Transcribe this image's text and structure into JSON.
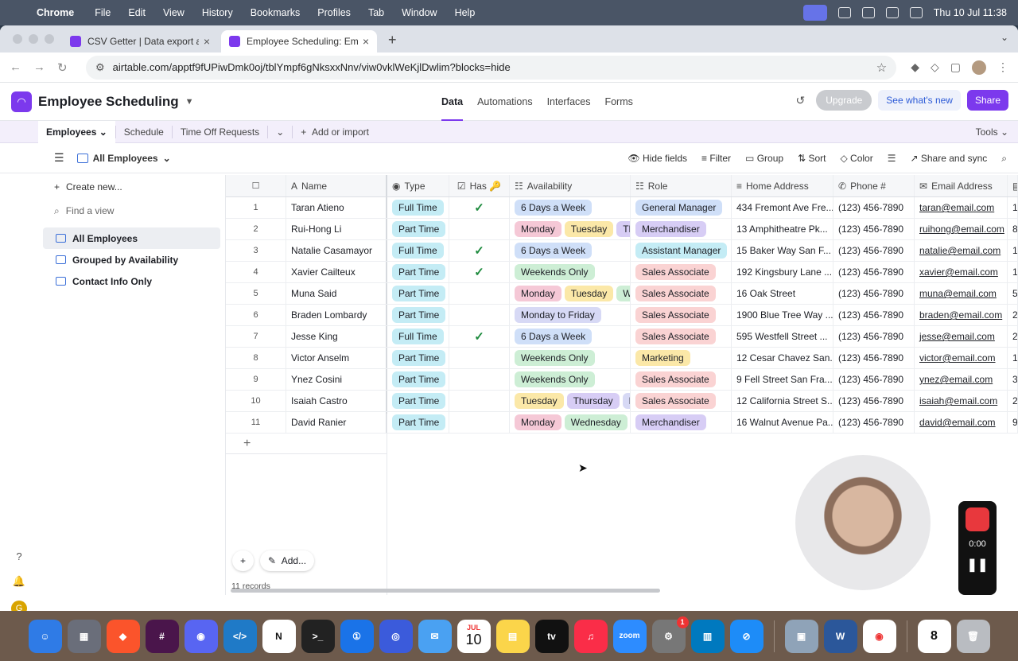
{
  "menubar": {
    "app": "Chrome",
    "items": [
      "File",
      "Edit",
      "View",
      "History",
      "Bookmarks",
      "Profiles",
      "Tab",
      "Window",
      "Help"
    ],
    "datetime": "Thu 10 Jul  11:38"
  },
  "browser": {
    "tabs": [
      {
        "title": "CSV Getter | Data export and",
        "favicon_color": "#7c39ed"
      },
      {
        "title": "Employee Scheduling: Emplo",
        "favicon_color": "#7c39ed"
      }
    ],
    "url": "airtable.com/apptf9fUPiwDmk0oj/tblYmpf6gNksxxNnv/viw0vklWeKjlDwlim?blocks=hide"
  },
  "app": {
    "base_name": "Employee Scheduling",
    "center_tabs": [
      "Data",
      "Automations",
      "Interfaces",
      "Forms"
    ],
    "upgrade": "Upgrade",
    "whats_new": "See what's new",
    "share": "Share"
  },
  "tables": {
    "active": "Employees",
    "others": [
      "Schedule",
      "Time Off Requests"
    ],
    "add": "Add or import",
    "tools": "Tools"
  },
  "view": {
    "name": "All Employees",
    "toolbar": [
      "Hide fields",
      "Filter",
      "Group",
      "Sort",
      "Color",
      "Share and sync"
    ]
  },
  "sidebar": {
    "create": "Create new...",
    "find_placeholder": "Find a view",
    "views": [
      "All Employees",
      "Grouped by Availability",
      "Contact Info Only"
    ]
  },
  "grid": {
    "columns": [
      "Name",
      "Type",
      "Has 🔑",
      "Availability",
      "Role",
      "Home Address",
      "Phone #",
      "Email Address"
    ],
    "rows": [
      {
        "n": "1",
        "name": "Taran Atieno",
        "type": "Full Time",
        "has": true,
        "avail": [
          [
            "6 Days a Week",
            "p-6d"
          ]
        ],
        "role": [
          "General Manager",
          "p-gm"
        ],
        "addr": "434 Fremont Ave Fre...",
        "phone": "(123) 456-7890",
        "email": "taran@email.com",
        "x": "1"
      },
      {
        "n": "2",
        "name": "Rui-Hong Li",
        "type": "Part Time",
        "has": false,
        "avail": [
          [
            "Monday",
            "p-mon"
          ],
          [
            "Tuesday",
            "p-tue"
          ],
          [
            "Thu",
            "p-thu"
          ]
        ],
        "role": [
          "Merchandiser",
          "p-mer"
        ],
        "addr": "13 Amphitheatre Pk...",
        "phone": "(123) 456-7890",
        "email": "ruihong@email.com",
        "x": "8"
      },
      {
        "n": "3",
        "name": "Natalie Casamayor",
        "type": "Full Time",
        "has": true,
        "avail": [
          [
            "6 Days a Week",
            "p-6d"
          ]
        ],
        "role": [
          "Assistant Manager",
          "p-am"
        ],
        "addr": "15 Baker Way San F...",
        "phone": "(123) 456-7890",
        "email": "natalie@email.com",
        "x": "1"
      },
      {
        "n": "4",
        "name": "Xavier Cailteux",
        "type": "Part Time",
        "has": true,
        "avail": [
          [
            "Weekends Only",
            "p-we"
          ]
        ],
        "role": [
          "Sales Associate",
          "p-sa"
        ],
        "addr": "192 Kingsbury Lane ...",
        "phone": "(123) 456-7890",
        "email": "xavier@email.com",
        "x": "1"
      },
      {
        "n": "5",
        "name": "Muna Said",
        "type": "Part Time",
        "has": false,
        "avail": [
          [
            "Monday",
            "p-mon"
          ],
          [
            "Tuesday",
            "p-tue"
          ],
          [
            "We",
            "p-wed"
          ]
        ],
        "role": [
          "Sales Associate",
          "p-sa"
        ],
        "addr": "16 Oak Street",
        "phone": "(123) 456-7890",
        "email": "muna@email.com",
        "x": "5"
      },
      {
        "n": "6",
        "name": "Braden Lombardy",
        "type": "Part Time",
        "has": false,
        "avail": [
          [
            "Monday to Friday",
            "p-mf"
          ]
        ],
        "role": [
          "Sales Associate",
          "p-sa"
        ],
        "addr": "1900 Blue Tree Way ...",
        "phone": "(123) 456-7890",
        "email": "braden@email.com",
        "x": "2"
      },
      {
        "n": "7",
        "name": "Jesse King",
        "type": "Full Time",
        "has": true,
        "avail": [
          [
            "6 Days a Week",
            "p-6d"
          ]
        ],
        "role": [
          "Sales Associate",
          "p-sa"
        ],
        "addr": "595 Westfell Street ...",
        "phone": "(123) 456-7890",
        "email": "jesse@email.com",
        "x": "2"
      },
      {
        "n": "8",
        "name": "Victor Anselm",
        "type": "Part Time",
        "has": false,
        "avail": [
          [
            "Weekends Only",
            "p-we"
          ]
        ],
        "role": [
          "Marketing",
          "p-mk"
        ],
        "addr": "12 Cesar Chavez San...",
        "phone": "(123) 456-7890",
        "email": "victor@email.com",
        "x": "1"
      },
      {
        "n": "9",
        "name": "Ynez Cosini",
        "type": "Part Time",
        "has": false,
        "avail": [
          [
            "Weekends Only",
            "p-we"
          ]
        ],
        "role": [
          "Sales Associate",
          "p-sa"
        ],
        "addr": "9 Fell Street San Fra...",
        "phone": "(123) 456-7890",
        "email": "ynez@email.com",
        "x": "3"
      },
      {
        "n": "10",
        "name": "Isaiah Castro",
        "type": "Part Time",
        "has": false,
        "avail": [
          [
            "Tuesday",
            "p-tue"
          ],
          [
            "Thursday",
            "p-thu"
          ],
          [
            "Fr",
            "p-mf"
          ]
        ],
        "role": [
          "Sales Associate",
          "p-sa"
        ],
        "addr": "12 California Street S...",
        "phone": "(123) 456-7890",
        "email": "isaiah@email.com",
        "x": "2"
      },
      {
        "n": "11",
        "name": "David Ranier",
        "type": "Part Time",
        "has": false,
        "avail": [
          [
            "Monday",
            "p-mon"
          ],
          [
            "Wednesday",
            "p-wed"
          ]
        ],
        "role": [
          "Merchandiser",
          "p-mer"
        ],
        "addr": "16 Walnut Avenue Pa...",
        "phone": "(123) 456-7890",
        "email": "david@email.com",
        "x": "9"
      }
    ],
    "record_count": "11 records",
    "add_label": "Add..."
  },
  "recorder": {
    "time": "0:00"
  },
  "dock": {
    "calendar_month": "JUL",
    "calendar_day": "10",
    "calendar2_day": "8",
    "badge": "1"
  }
}
